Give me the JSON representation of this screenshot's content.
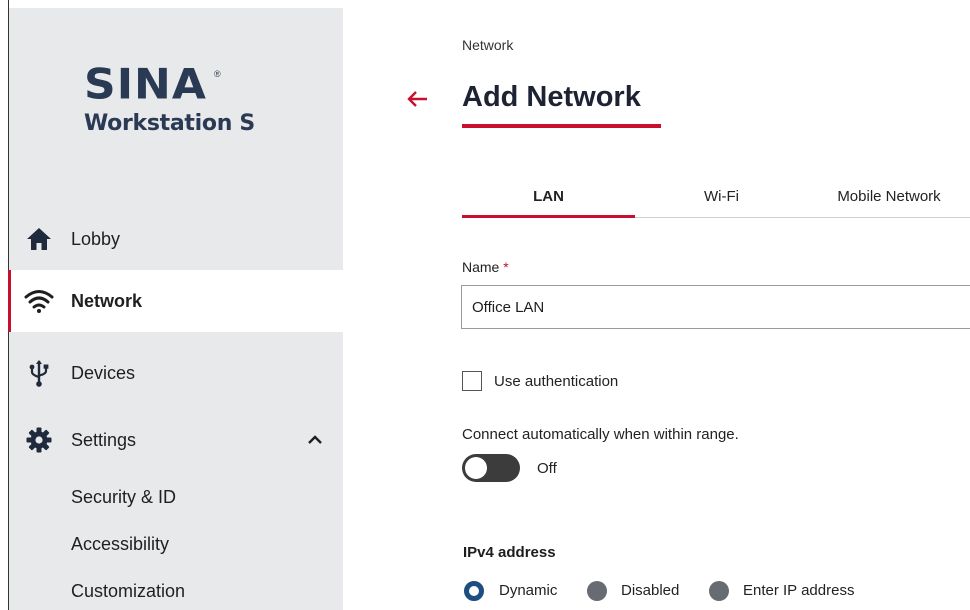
{
  "sidebar": {
    "logo_word": "SINA",
    "logo_reg": "®",
    "logo_sub": "Workstation S",
    "items": [
      {
        "label": "Lobby",
        "icon": "home-icon"
      },
      {
        "label": "Network",
        "icon": "wifi-icon",
        "active": true
      },
      {
        "label": "Devices",
        "icon": "usb-icon"
      },
      {
        "label": "Settings",
        "icon": "gear-icon",
        "expanded": true
      }
    ],
    "sub_items": [
      {
        "label": "Security & ID"
      },
      {
        "label": "Accessibility"
      },
      {
        "label": "Customization"
      }
    ]
  },
  "main": {
    "breadcrumb": "Network",
    "title": "Add Network",
    "tabs": [
      {
        "label": "LAN",
        "active": true
      },
      {
        "label": "Wi-Fi"
      },
      {
        "label": "Mobile Network"
      }
    ],
    "name_field": {
      "label": "Name",
      "required_mark": "*",
      "value": "Office LAN"
    },
    "use_auth": {
      "label": "Use authentication",
      "checked": false
    },
    "auto_connect": {
      "label": "Connect automatically when within range.",
      "state_text": "Off",
      "on": false
    },
    "ipv4": {
      "label": "IPv4 address",
      "options": [
        {
          "label": "Dynamic",
          "selected": true
        },
        {
          "label": "Disabled",
          "selected": false
        },
        {
          "label": "Enter IP address",
          "selected": false
        }
      ]
    }
  },
  "colors": {
    "accent": "#c8102e",
    "sidebar_bg": "#e8e9ea",
    "logo": "#2a3a54",
    "radio_selected": "#1c4e7f",
    "toggle_off": "#3c3c3c"
  }
}
